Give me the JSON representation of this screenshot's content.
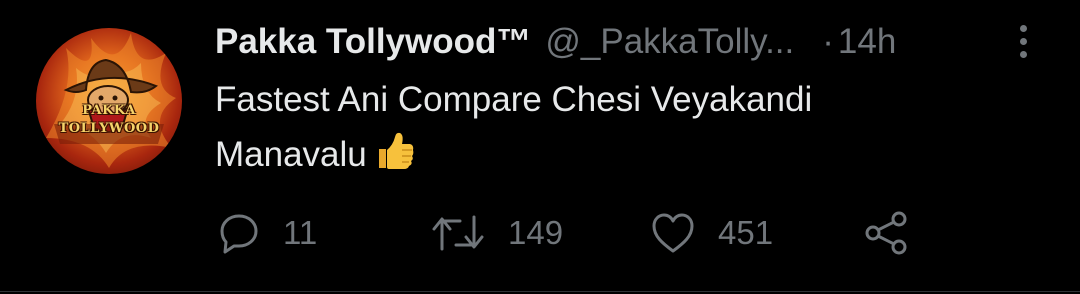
{
  "tweet": {
    "display_name": "Pakka Tollywood™",
    "handle": "@_PakkaTolly...",
    "separator": "·",
    "timestamp": "14h",
    "text_line1": "Fastest Ani Compare Chesi Veyakandi",
    "text_line2": "Manavalu",
    "emoji": "thumbs-up",
    "avatar_logo_line1": "PAKKA",
    "avatar_logo_line2": "TOLLYWOOD"
  },
  "actions": {
    "reply_count": "11",
    "retweet_count": "149",
    "like_count": "451"
  },
  "colors": {
    "background": "#000000",
    "primary_text": "#e7e9ea",
    "secondary_text": "#71767b",
    "emoji_yellow": "#f7c13c"
  },
  "icons": [
    "reply-icon",
    "retweet-icon",
    "like-icon",
    "share-icon",
    "more-options-icon",
    "thumbs-up-emoji"
  ]
}
